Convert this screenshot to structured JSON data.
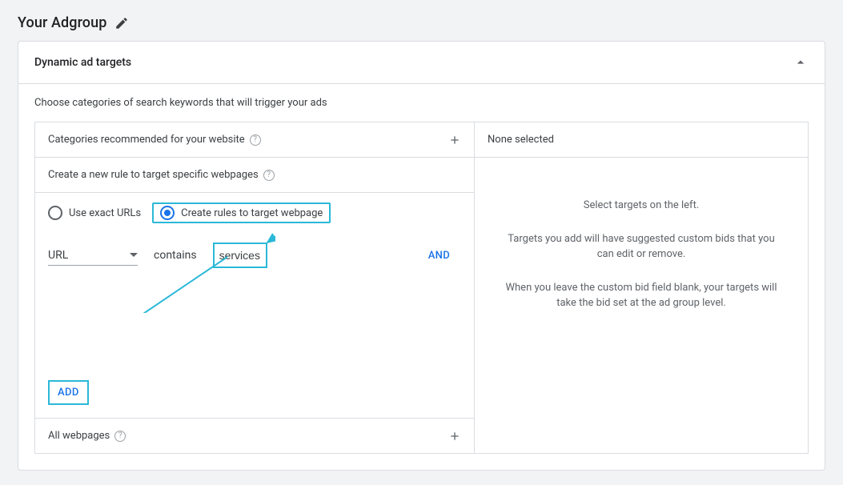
{
  "header": {
    "title": "Your Adgroup"
  },
  "card": {
    "title": "Dynamic ad targets",
    "intro": "Choose categories of search keywords that will trigger your ads"
  },
  "left": {
    "categories_label": "Categories recommended for your website",
    "create_rule_label": "Create a new rule to target specific webpages",
    "radio_exact": "Use exact URLs",
    "radio_rules": "Create rules to target webpage",
    "select_field": "URL",
    "operator": "contains",
    "value": "services",
    "and_label": "AND",
    "add_label": "ADD",
    "all_webpages_label": "All webpages"
  },
  "right": {
    "header": "None selected",
    "line1": "Select targets on the left.",
    "line2": "Targets you add will have suggested custom bids that you can edit or remove.",
    "line3": "When you leave the custom bid field blank, your targets will take the bid set at the ad group level."
  }
}
